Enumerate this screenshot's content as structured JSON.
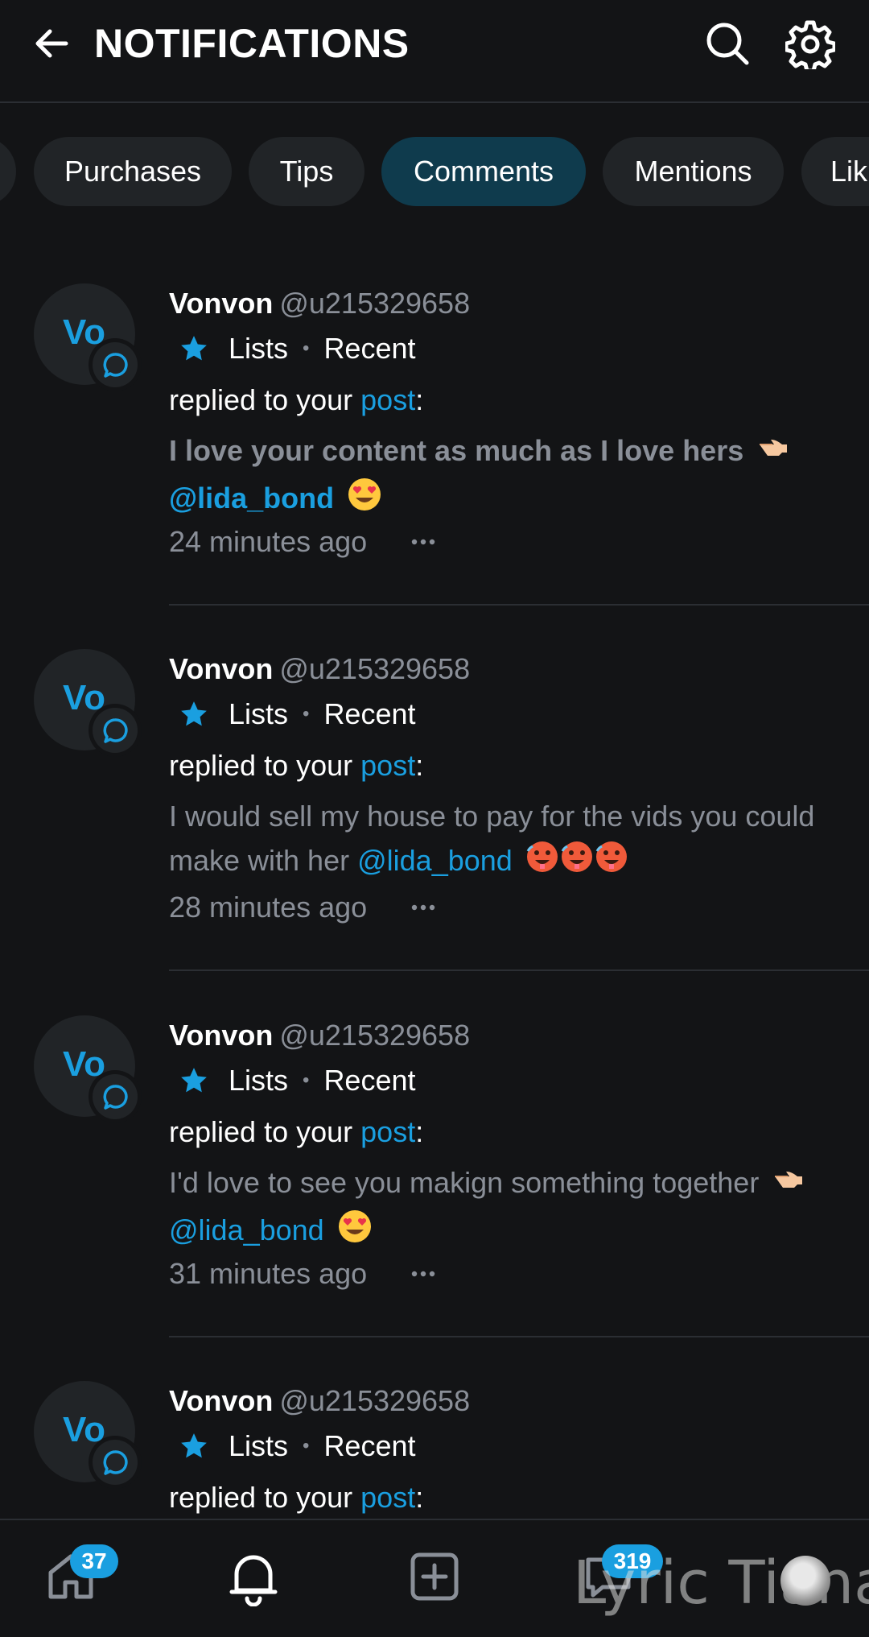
{
  "header": {
    "title": "NOTIFICATIONS",
    "back_icon": "arrow-left-icon",
    "search_icon": "search-icon",
    "settings_icon": "gear-icon"
  },
  "tabs": [
    {
      "label": "",
      "active": false
    },
    {
      "label": "Purchases",
      "active": false
    },
    {
      "label": "Tips",
      "active": false
    },
    {
      "label": "Comments",
      "active": true
    },
    {
      "label": "Mentions",
      "active": false
    },
    {
      "label": "Lik",
      "active": false
    }
  ],
  "notifications": [
    {
      "avatar_initials": "Vo",
      "name": "Vonvon",
      "handle": "@u215329658",
      "list_label": "Lists",
      "list_sub": "Recent",
      "action_text": "replied to your",
      "action_link": "post",
      "action_suffix": ":",
      "comment_text": "I love your content as much as I love hers",
      "comment_mention": "@lida_bond",
      "time": "24 minutes ago"
    },
    {
      "avatar_initials": "Vo",
      "name": "Vonvon",
      "handle": "@u215329658",
      "list_label": "Lists",
      "list_sub": "Recent",
      "action_text": "replied to your",
      "action_link": "post",
      "action_suffix": ":",
      "comment_text": "I would sell my house to pay for the vids you could make with her",
      "comment_mention": "@lida_bond",
      "time": "28 minutes ago"
    },
    {
      "avatar_initials": "Vo",
      "name": "Vonvon",
      "handle": "@u215329658",
      "list_label": "Lists",
      "list_sub": "Recent",
      "action_text": "replied to your",
      "action_link": "post",
      "action_suffix": ":",
      "comment_text": "I'd love to see you makign something together",
      "comment_mention": "@lida_bond",
      "time": "31 minutes ago"
    },
    {
      "avatar_initials": "Vo",
      "name": "Vonvon",
      "handle": "@u215329658",
      "list_label": "Lists",
      "list_sub": "Recent",
      "action_text": "replied to your",
      "action_link": "post",
      "action_suffix": ":"
    }
  ],
  "bottom_nav": {
    "home_badge": "37",
    "messages_badge": "319",
    "watermark": "Lyric Tiana"
  },
  "colors": {
    "background": "#131416",
    "accent": "#1a9fe0",
    "active_tab": "#0f3b4d",
    "muted_text": "#8a8f98"
  }
}
